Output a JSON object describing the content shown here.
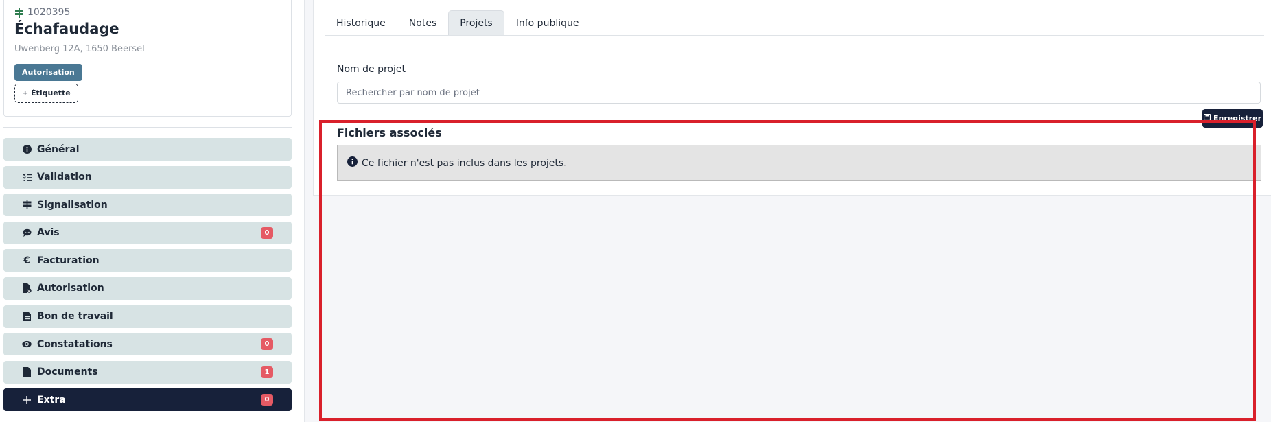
{
  "record": {
    "reference": "1020395",
    "title": "Échafaudage",
    "address": "Uwenberg 12A, 1650 Beersel",
    "badge": "Autorisation",
    "add_tag_label": "+ Étiquette"
  },
  "nav": {
    "items": [
      {
        "label": "Général",
        "icon": "info-circle-icon",
        "count": null
      },
      {
        "label": "Validation",
        "icon": "checklist-icon",
        "count": null
      },
      {
        "label": "Signalisation",
        "icon": "signpost-icon",
        "count": null
      },
      {
        "label": "Avis",
        "icon": "speech-bubble-icon",
        "count": "0"
      },
      {
        "label": "Facturation",
        "icon": "euro-icon",
        "count": null
      },
      {
        "label": "Autorisation",
        "icon": "file-check-icon",
        "count": null
      },
      {
        "label": "Bon de travail",
        "icon": "file-icon",
        "count": null
      },
      {
        "label": "Constatations",
        "icon": "eye-icon",
        "count": "0"
      },
      {
        "label": "Documents",
        "icon": "file-icon",
        "count": "1"
      },
      {
        "label": "Extra",
        "icon": "plus-icon",
        "count": "0"
      }
    ]
  },
  "tabs": [
    {
      "label": "Historique",
      "active": false
    },
    {
      "label": "Notes",
      "active": false
    },
    {
      "label": "Projets",
      "active": true
    },
    {
      "label": "Info publique",
      "active": false
    }
  ],
  "project": {
    "field_label": "Nom de projet",
    "search_placeholder": "Rechercher par nom de projet",
    "save_label": "Enregistrer"
  },
  "files": {
    "title": "Fichiers associés",
    "message": "Ce fichier n'est pas inclus dans les projets."
  },
  "colors": {
    "accent_dark": "#17213a",
    "badge_blue": "#4a7894",
    "nav_bg": "#d7e3e4",
    "count_red": "#e55a64",
    "highlight_red": "#d9202b",
    "signpost_green": "#2f7d4f"
  }
}
